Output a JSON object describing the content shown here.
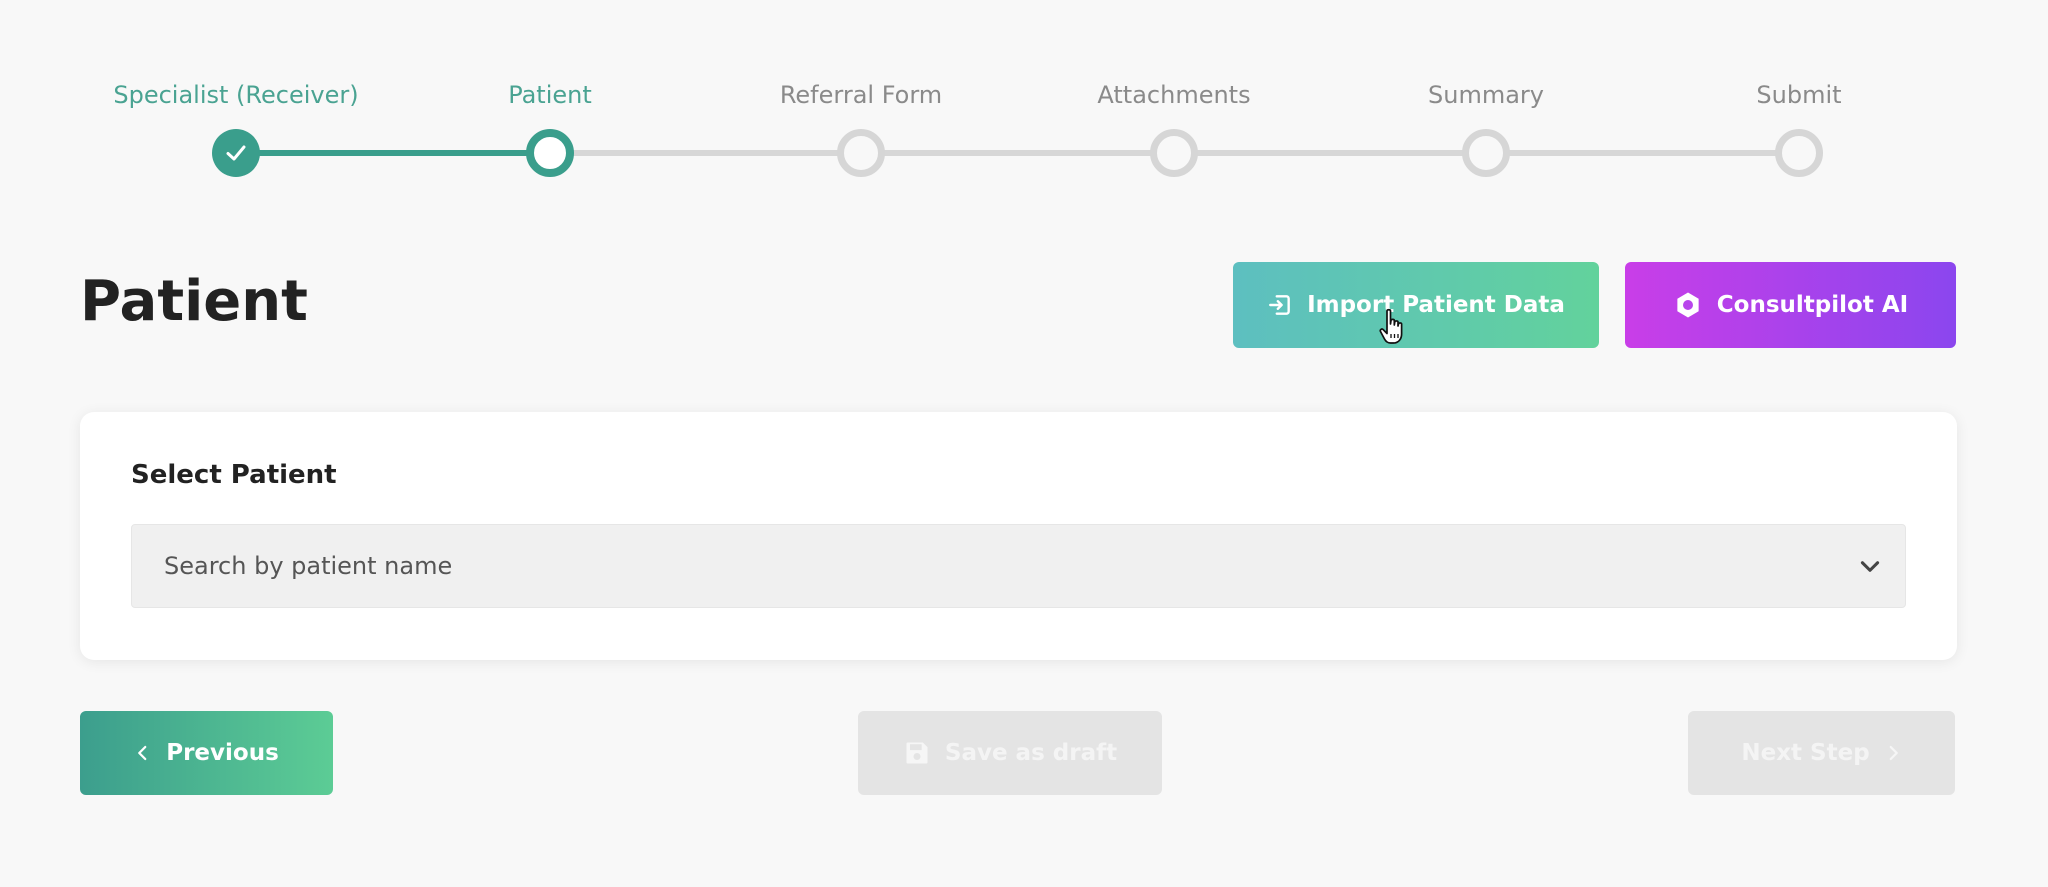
{
  "stepper": {
    "steps": [
      {
        "label": "Specialist (Receiver)",
        "state": "done"
      },
      {
        "label": "Patient",
        "state": "current"
      },
      {
        "label": "Referral Form",
        "state": "todo"
      },
      {
        "label": "Attachments",
        "state": "todo"
      },
      {
        "label": "Summary",
        "state": "todo"
      },
      {
        "label": "Submit",
        "state": "todo"
      }
    ]
  },
  "header": {
    "title": "Patient",
    "import_label": "Import Patient Data",
    "ai_label": "Consultpilot AI"
  },
  "form": {
    "select_label": "Select Patient",
    "select_placeholder": "Search by patient name"
  },
  "footer": {
    "previous_label": "Previous",
    "draft_label": "Save as draft",
    "next_label": "Next Step"
  },
  "colors": {
    "primary": "#3a9e8c",
    "ai_gradient_start": "#c93ee8",
    "ai_gradient_end": "#8b46ee",
    "disabled": "#e4e4e4"
  },
  "icons": {
    "step_done": "check-icon",
    "import": "import-icon",
    "ai": "ai-logo-icon",
    "select": "chevron-down-icon",
    "previous": "chevron-left-icon",
    "draft": "save-icon",
    "next": "chevron-right-icon"
  }
}
